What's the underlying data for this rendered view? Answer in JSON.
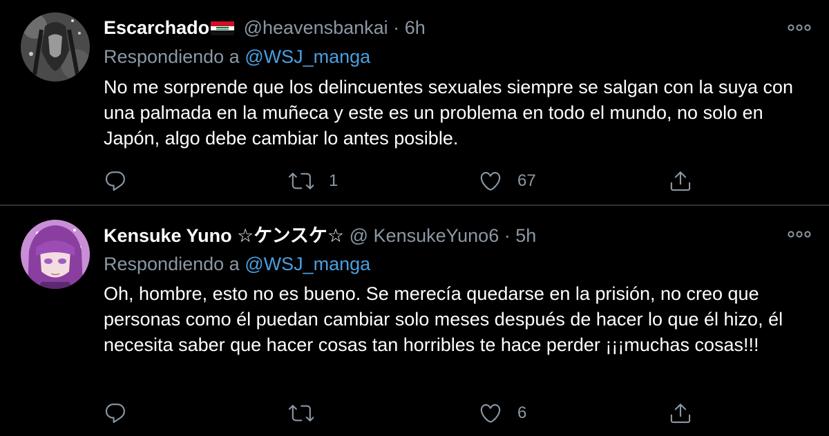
{
  "colors": {
    "background": "#000000",
    "divider": "#2f3336",
    "secondary_text": "#8b98a5",
    "mention": "#4a9fe0",
    "primary_text": "#ffffff"
  },
  "tweets": [
    {
      "display_name": "Escarchado",
      "flag_icon": "iraq-flag-emoji",
      "handle": "@heavensbankai",
      "separator": "·",
      "time": "6h",
      "replying_label": "Respondiendo a",
      "replying_to": "@WSJ_manga",
      "text": "No me sorprende que los delincuentes sexuales siempre se salgan con la suya con una palmada en la muñeca y este es un problema en todo el mundo, no solo en Japón, algo debe cambiar lo antes posible.",
      "reply_count": "",
      "retweet_count": "1",
      "like_count": "67"
    },
    {
      "display_name": "Kensuke Yuno ☆ケンスケ☆",
      "handle": "@ KensukeYuno6",
      "separator": "·",
      "time": "5h",
      "replying_label": "Respondiendo a",
      "replying_to": "@WSJ_manga",
      "text": "Oh, hombre, esto no es bueno. Se merecía quedarse en la prisión, no creo que personas como él puedan cambiar solo meses después de hacer lo que él hizo, él necesita saber que hacer cosas tan horribles te hace perder ¡¡¡muchas cosas!!!",
      "reply_count": "",
      "retweet_count": "",
      "like_count": "6"
    }
  ],
  "icons": {
    "more": "more-horizontal-icon",
    "reply": "reply-bubble-icon",
    "retweet": "retweet-icon",
    "like": "heart-icon",
    "share": "share-icon"
  }
}
